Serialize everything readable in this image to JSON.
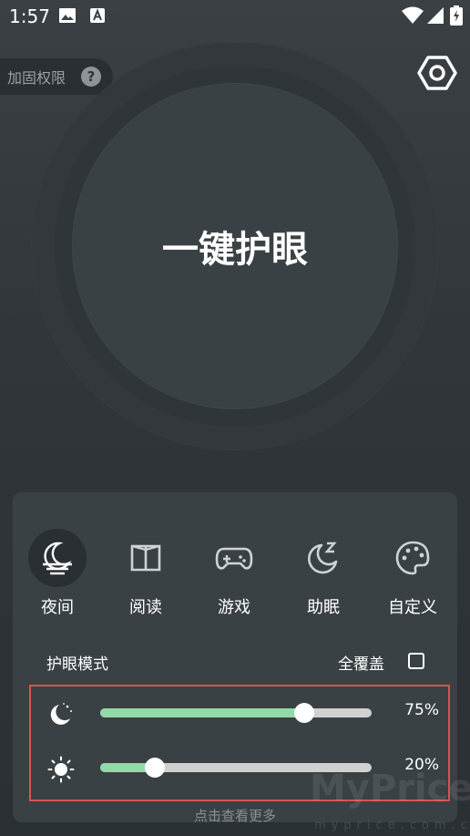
{
  "status_bar": {
    "time": "1:57"
  },
  "header": {
    "boost_label": "加固权限",
    "help_glyph": "?"
  },
  "main": {
    "onekey_label": "一键护眼"
  },
  "modes": [
    {
      "label": "夜间",
      "icon": "night-icon",
      "active": true
    },
    {
      "label": "阅读",
      "icon": "book-icon",
      "active": false
    },
    {
      "label": "游戏",
      "icon": "gamepad-icon",
      "active": false
    },
    {
      "label": "助眠",
      "icon": "sleep-icon",
      "active": false
    },
    {
      "label": "自定义",
      "icon": "palette-icon",
      "active": false
    }
  ],
  "eye_mode": {
    "title": "护眼模式",
    "cover_label": "全覆盖",
    "cover_checked": false
  },
  "sliders": [
    {
      "name": "filter",
      "icon": "moon-icon",
      "value": 75,
      "value_text": "75%"
    },
    {
      "name": "brightness",
      "icon": "sun-icon",
      "value": 20,
      "value_text": "20%"
    }
  ],
  "footer": {
    "more_label": "点击查看更多"
  },
  "watermark": {
    "brand": "MyPrice",
    "site": "myprice.com.cn"
  },
  "colors": {
    "accent": "#8fdca6",
    "highlight_border": "#d9534f",
    "panel": "#3a4145"
  }
}
